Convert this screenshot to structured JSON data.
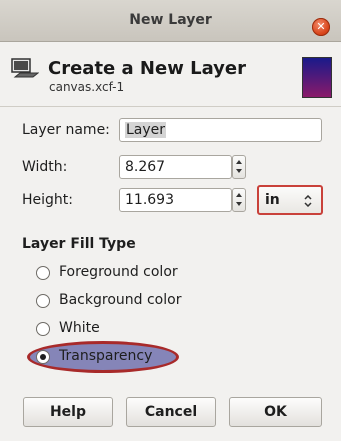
{
  "window": {
    "title": "New Layer",
    "close_glyph": "✕"
  },
  "header": {
    "title": "Create a New Layer",
    "subtitle": "canvas.xcf-1",
    "icon": "layer-icon"
  },
  "form": {
    "layer_name_label": "Layer name:",
    "layer_name_value": "Layer",
    "width_label": "Width:",
    "width_value": "8.267",
    "height_label": "Height:",
    "height_value": "11.693",
    "unit_value": "in"
  },
  "fill": {
    "section_title": "Layer Fill Type",
    "options": [
      {
        "label": "Foreground color",
        "checked": false
      },
      {
        "label": "Background color",
        "checked": false
      },
      {
        "label": "White",
        "checked": false
      },
      {
        "label": "Transparency",
        "checked": true
      }
    ]
  },
  "buttons": {
    "help": "Help",
    "cancel": "Cancel",
    "ok": "OK"
  },
  "colors": {
    "highlight_fill": "#8585b8",
    "highlight_border": "#a82a2a",
    "close_button": "#d9461c"
  }
}
